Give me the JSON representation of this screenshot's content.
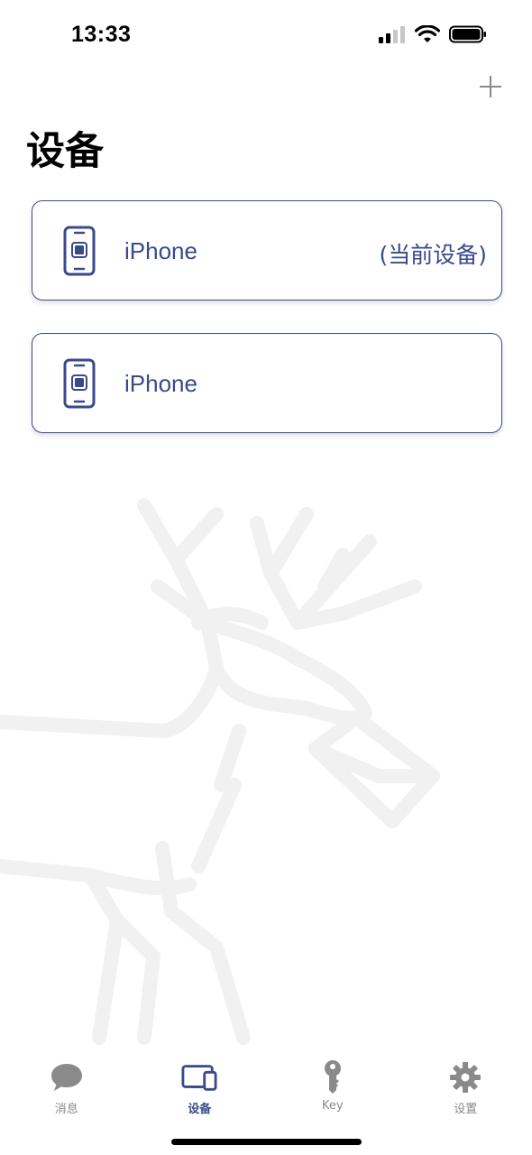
{
  "status_bar": {
    "time": "13:33",
    "signal_icon": "cellular-signal-icon",
    "wifi_icon": "wifi-icon",
    "battery_icon": "battery-icon"
  },
  "header": {
    "add_icon": "plus-icon",
    "title": "设备"
  },
  "devices": [
    {
      "name": "iPhone",
      "badge": "(当前设备)",
      "icon": "phone-icon"
    },
    {
      "name": "iPhone",
      "badge": "",
      "icon": "phone-icon"
    }
  ],
  "tab_bar": {
    "tabs": [
      {
        "label": "消息",
        "icon": "chat-bubble-icon",
        "active": false
      },
      {
        "label": "设备",
        "icon": "devices-icon",
        "active": true
      },
      {
        "label": "Key",
        "icon": "key-icon",
        "active": false
      },
      {
        "label": "设置",
        "icon": "gear-icon",
        "active": false
      }
    ]
  },
  "colors": {
    "accent": "#3a4a8a",
    "inactive": "#8a8a8a",
    "watermark": "#f2f2f2"
  }
}
